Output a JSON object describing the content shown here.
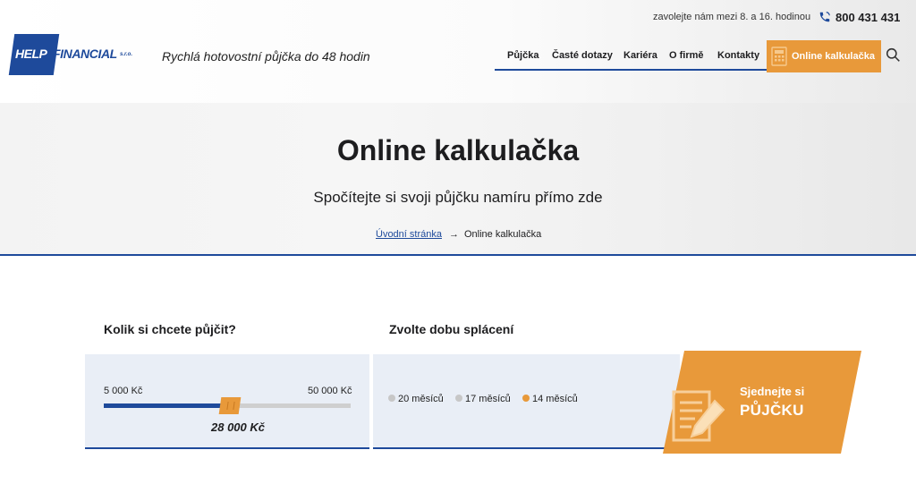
{
  "header": {
    "logo": {
      "help": "HELP",
      "financial": "FINANCIAL",
      "sro": "s.r.o."
    },
    "tagline": "Rychlá hotovostní půjčka do 48 hodin",
    "call_info": "zavolejte nám mezi 8. a 16. hodinou",
    "phone": "800 431 431",
    "nav": [
      {
        "label": "Půjčka"
      },
      {
        "label": "Časté dotazy"
      },
      {
        "label": "Kariéra"
      },
      {
        "label": "O firmě"
      },
      {
        "label": "Kontakty"
      }
    ],
    "calc_button": "Online kalkulačka"
  },
  "hero": {
    "title": "Online kalkulačka",
    "subtitle": "Spočítejte si svoji půjčku namíru přímo zde",
    "breadcrumb": {
      "home": "Úvodní stránka",
      "arrow": "→",
      "current": "Online kalkulačka"
    }
  },
  "calculator": {
    "amount_heading": "Kolik si chcete půjčit?",
    "term_heading": "Zvolte dobu splácení",
    "min_label": "5 000 Kč",
    "max_label": "50 000 Kč",
    "min_value": 5000,
    "max_value": 50000,
    "current_value": 28000,
    "amount_display": "28 000 Kč",
    "terms": [
      {
        "label": "20 měsíců",
        "selected": false
      },
      {
        "label": "17 měsíců",
        "selected": false
      },
      {
        "label": "14 měsíců",
        "selected": true
      }
    ],
    "cta_line1": "Sjednejte si",
    "cta_line2": "PŮJČKU"
  },
  "colors": {
    "brand_blue": "#1e4a9b",
    "accent_orange": "#e8993a",
    "panel_bg": "#e9eef6"
  }
}
